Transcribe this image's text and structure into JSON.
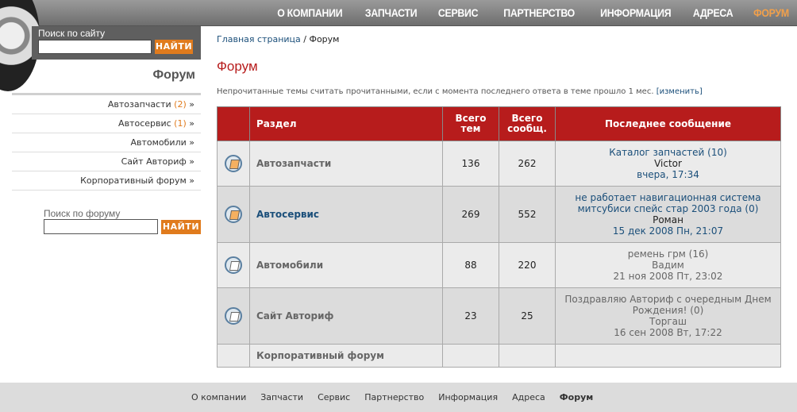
{
  "nav": [
    "О КОМПАНИИ",
    "ЗАПЧАСТИ",
    "СЕРВИС",
    "ПАРТНЕРСТВО",
    "ИНФОРМАЦИЯ",
    "АДРЕСА",
    "ФОРУМ"
  ],
  "site_search": {
    "label": "Поиск по сайту",
    "button": "НАЙТИ"
  },
  "sidebar": {
    "title": "Форум",
    "items": [
      {
        "label": "Автозапчасти",
        "count": "(2)",
        "arrow": "»"
      },
      {
        "label": "Автосервис",
        "count": "(1)",
        "arrow": "»"
      },
      {
        "label": "Автомобили",
        "count": "",
        "arrow": "»"
      },
      {
        "label": "Сайт Авториф",
        "count": "",
        "arrow": "»"
      },
      {
        "label": "Корпоративный форум",
        "count": "",
        "arrow": "»"
      }
    ]
  },
  "forum_search": {
    "label": "Поиск по форуму",
    "button": "НАЙТИ"
  },
  "breadcrumb": {
    "home": "Главная страница",
    "sep": " / ",
    "current": "Форум"
  },
  "page_title": "Форум",
  "notice": {
    "text": "Непрочитанные темы считать прочитанными, если с момента последнего ответа в теме прошло 1 мес.",
    "link": "[изменить]"
  },
  "table": {
    "headers": [
      "Раздел",
      "Всего тем",
      "Всего сообщ.",
      "Последнее сообщение"
    ],
    "rows": [
      {
        "name": "Автозапчасти",
        "topics": "136",
        "posts": "262",
        "last_title": "Каталог запчастей (10)",
        "last_user": "Victor",
        "last_date": "вчера, 17:34"
      },
      {
        "name": "Автосервис",
        "topics": "269",
        "posts": "552",
        "last_title": "не работает навигационная система митсубиси спейс стар 2003 года (0)",
        "last_user": "Роман",
        "last_date": "15 дек 2008 Пн, 21:07"
      },
      {
        "name": "Автомобили",
        "topics": "88",
        "posts": "220",
        "last_title": "ремень грм (16)",
        "last_user": "Вадим",
        "last_date": "21 ноя 2008 Пт, 23:02"
      },
      {
        "name": "Сайт Авториф",
        "topics": "23",
        "posts": "25",
        "last_title": "Поздравляю Авториф с очередным Днем Рождения! (0)",
        "last_user": "Торгаш",
        "last_date": "16 сен 2008 Вт, 17:22"
      },
      {
        "name": "Корпоративный форум",
        "topics": "",
        "posts": "",
        "last_title": "",
        "last_user": "",
        "last_date": ""
      }
    ]
  },
  "footer": [
    "О компании",
    "Запчасти",
    "Сервис",
    "Партнерство",
    "Информация",
    "Адреса",
    "Форум"
  ]
}
